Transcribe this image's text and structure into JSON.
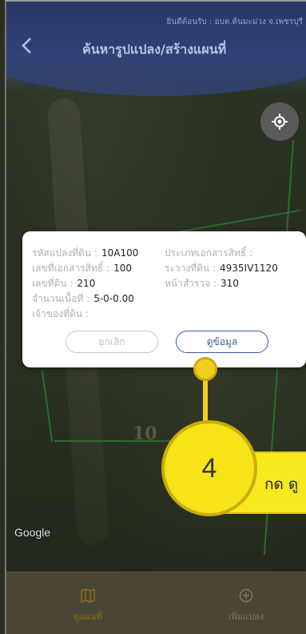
{
  "header": {
    "subtitle": "ยินดีต้อนรับ : อบต.ต้นมะม่วง จ.เพชรบุรี",
    "title": "ค้นหารูปแปลง/สร้างแผนที่",
    "back_icon": "chevron-left-icon"
  },
  "map": {
    "watermark": "Google",
    "faded_label": "10",
    "locate_icon": "crosshair-icon"
  },
  "dialog": {
    "fields": {
      "parcel_code_label": "รหัสแปลงที่ดิน :",
      "parcel_code_value": "10A100",
      "doc_type_label": "ประเภทเอกสารสิทธิ์ :",
      "doc_type_value": "",
      "doc_number_label": "เลขที่เอกสารสิทธิ์ :",
      "doc_number_value": "100",
      "survey_sheet_label": "ระวางที่ดิน :",
      "survey_sheet_value": "4935IV1120",
      "land_number_label": "เลขที่ดิน :",
      "land_number_value": "210",
      "survey_page_label": "หน้าสำรวจ :",
      "survey_page_value": "310",
      "area_label": "จำนวนเนื้อที่ :",
      "area_value": "5-0-0.00",
      "owner_label": "เจ้าของที่ดิน :",
      "owner_value": ""
    },
    "cancel_label": "ยกเลิก",
    "view_label": "ดูข้อมูล"
  },
  "callout": {
    "step": "4",
    "text": "กด ดู"
  },
  "bottom_nav": {
    "items": [
      {
        "label": "ดูแผนที่",
        "icon": "map-icon"
      },
      {
        "label": "เพิ่มแปลง",
        "icon": "plus-circle-icon"
      }
    ]
  }
}
